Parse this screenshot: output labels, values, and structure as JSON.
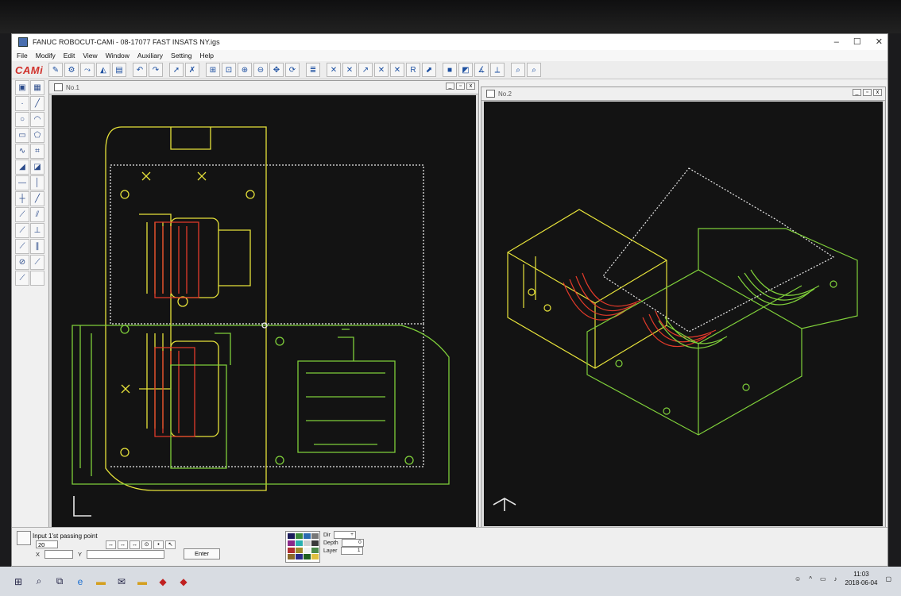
{
  "window": {
    "title": "FANUC ROBOCUT-CAMi - 08-17077 FAST INSATS NY.igs",
    "controls": [
      "–",
      "☐",
      "✕"
    ]
  },
  "menu": [
    "File",
    "Modify",
    "Edit",
    "View",
    "Window",
    "Auxiliary",
    "Setting",
    "Help"
  ],
  "toolbar": {
    "brand": "CAMi"
  },
  "views": [
    {
      "title": "No.1"
    },
    {
      "title": "No.2"
    }
  ],
  "status": {
    "prompt": "Input 1'st passing point",
    "zoom": "20",
    "x_label": "X",
    "y_label": "Y",
    "enter_label": "Enter"
  },
  "props": {
    "dir_label": "Dir",
    "dir_value": "+",
    "depth_label": "Depth",
    "depth_value": "0",
    "layer_label": "Layer",
    "layer_value": "1"
  },
  "palette": [
    "#1b1b5a",
    "#3a8a3a",
    "#2a6ab0",
    "#777777",
    "#8a2a8a",
    "#2ab0b0",
    "#d0d0d0",
    "#3a3a3a",
    "#b03030",
    "#a08a2a",
    "#f0f0f0",
    "#4a8a4a",
    "#8a6a2a",
    "#2a2a8a",
    "#1f5f1f",
    "#e0c040"
  ],
  "taskbar": {
    "time": "11:03",
    "date": "2018-06-04"
  },
  "colors": {
    "wire_yellow": "#e6e23a",
    "wire_green": "#7fcf3a",
    "wire_red": "#e23a2a",
    "wire_white": "#e8e8e8",
    "canvas": "#131313"
  }
}
